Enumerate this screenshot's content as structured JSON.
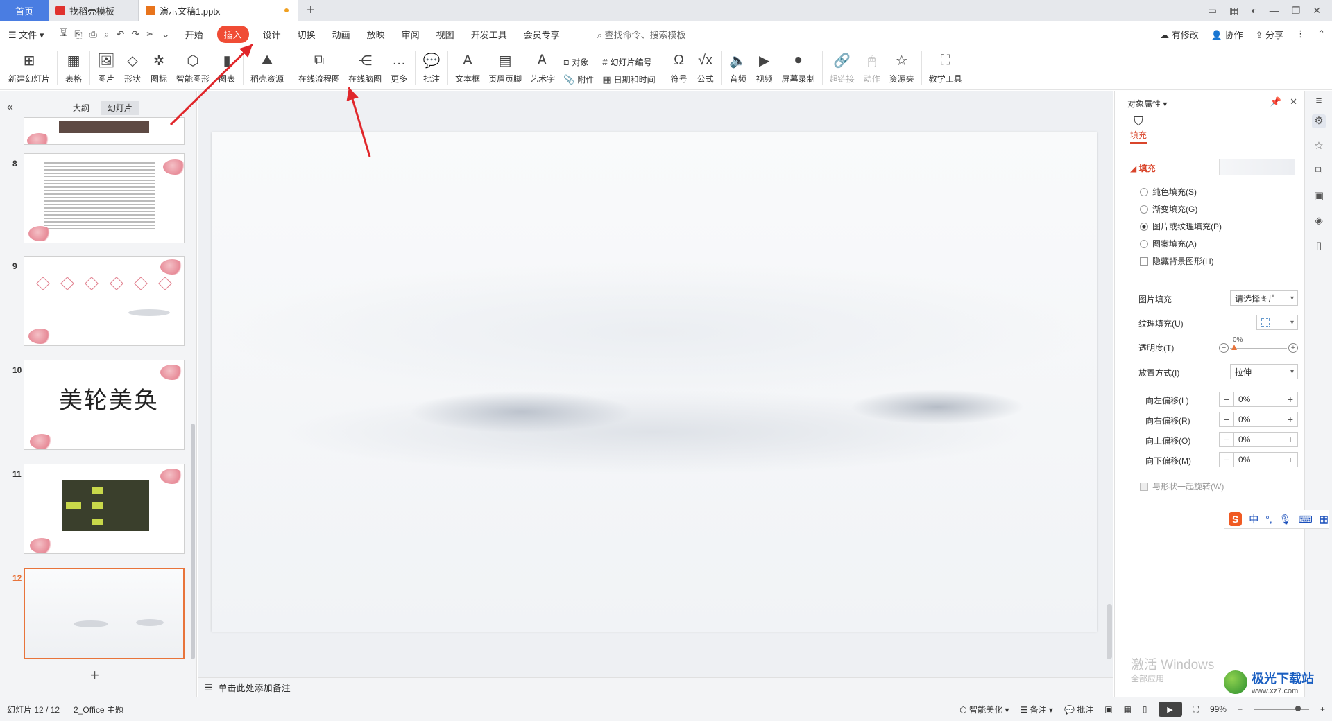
{
  "tabs": {
    "home": "首页",
    "template": "找稻壳模板",
    "document": "演示文稿1.pptx",
    "add": "+"
  },
  "menu": {
    "file": "文件",
    "items": [
      "开始",
      "插入",
      "设计",
      "切换",
      "动画",
      "放映",
      "审阅",
      "视图",
      "开发工具",
      "会员专享"
    ],
    "active": "插入",
    "search_placeholder": "查找命令、搜索模板",
    "right": {
      "modified": "有修改",
      "collab": "协作",
      "share": "分享"
    }
  },
  "ribbon": {
    "new_slide": "新建幻灯片",
    "table": "表格",
    "picture": "图片",
    "shape": "形状",
    "icon": "图标",
    "smart_graphic": "智能图形",
    "chart": "图表",
    "daoke_resource": "稻壳资源",
    "online_flowchart": "在线流程图",
    "online_mindmap": "在线脑图",
    "more": "更多",
    "comment": "批注",
    "textbox": "文本框",
    "header_footer": "页眉页脚",
    "wordart": "艺术字",
    "object": "对象",
    "attachment": "附件",
    "slide_number": "幻灯片编号",
    "date_time": "日期和时间",
    "symbol": "符号",
    "formula": "公式",
    "audio": "音频",
    "video": "视频",
    "screen_record": "屏幕录制",
    "hyperlink": "超链接",
    "action": "动作",
    "resource_folder": "资源夹",
    "teaching_tools": "教学工具"
  },
  "left_panel": {
    "outline_tab": "大纲",
    "slides_tab": "幻灯片",
    "slide_numbers": [
      "8",
      "9",
      "10",
      "11",
      "12"
    ],
    "slide10_title": "美轮美奂",
    "selected_slide": "12"
  },
  "notes": {
    "placeholder": "单击此处添加备注"
  },
  "props": {
    "title": "对象属性",
    "fill_tab": "填充",
    "fill_section": "填充",
    "options": [
      {
        "label": "纯色填充(S)",
        "selected": false
      },
      {
        "label": "渐变填充(G)",
        "selected": false
      },
      {
        "label": "图片或纹理填充(P)",
        "selected": true
      },
      {
        "label": "图案填充(A)",
        "selected": false
      }
    ],
    "hide_bg": "隐藏背景图形(H)",
    "picture_fill_label": "图片填充",
    "picture_fill_value": "请选择图片",
    "texture_fill_label": "纹理填充(U)",
    "transparency_label": "透明度(T)",
    "transparency_value": "0%",
    "placement_label": "放置方式(I)",
    "placement_value": "拉伸",
    "offsets": [
      {
        "label": "向左偏移(L)",
        "value": "0%"
      },
      {
        "label": "向右偏移(R)",
        "value": "0%"
      },
      {
        "label": "向上偏移(O)",
        "value": "0%"
      },
      {
        "label": "向下偏移(M)",
        "value": "0%"
      }
    ],
    "rotate_with_shape": "与形状一起旋转(W)"
  },
  "ime": {
    "lang": "中"
  },
  "watermark": {
    "activate": "激活 Windows",
    "sub": "全部应用",
    "site_name": "极光下载站",
    "site_url": "www.xz7.com"
  },
  "status": {
    "slide_count": "幻灯片 12 / 12",
    "theme": "2_Office 主题",
    "smart_beautify": "智能美化",
    "notes": "备注",
    "comments": "批注",
    "zoom": "99%"
  },
  "colors": {
    "accent": "#f04c35",
    "home_tab": "#4a7de2",
    "selection": "#e8743b"
  }
}
